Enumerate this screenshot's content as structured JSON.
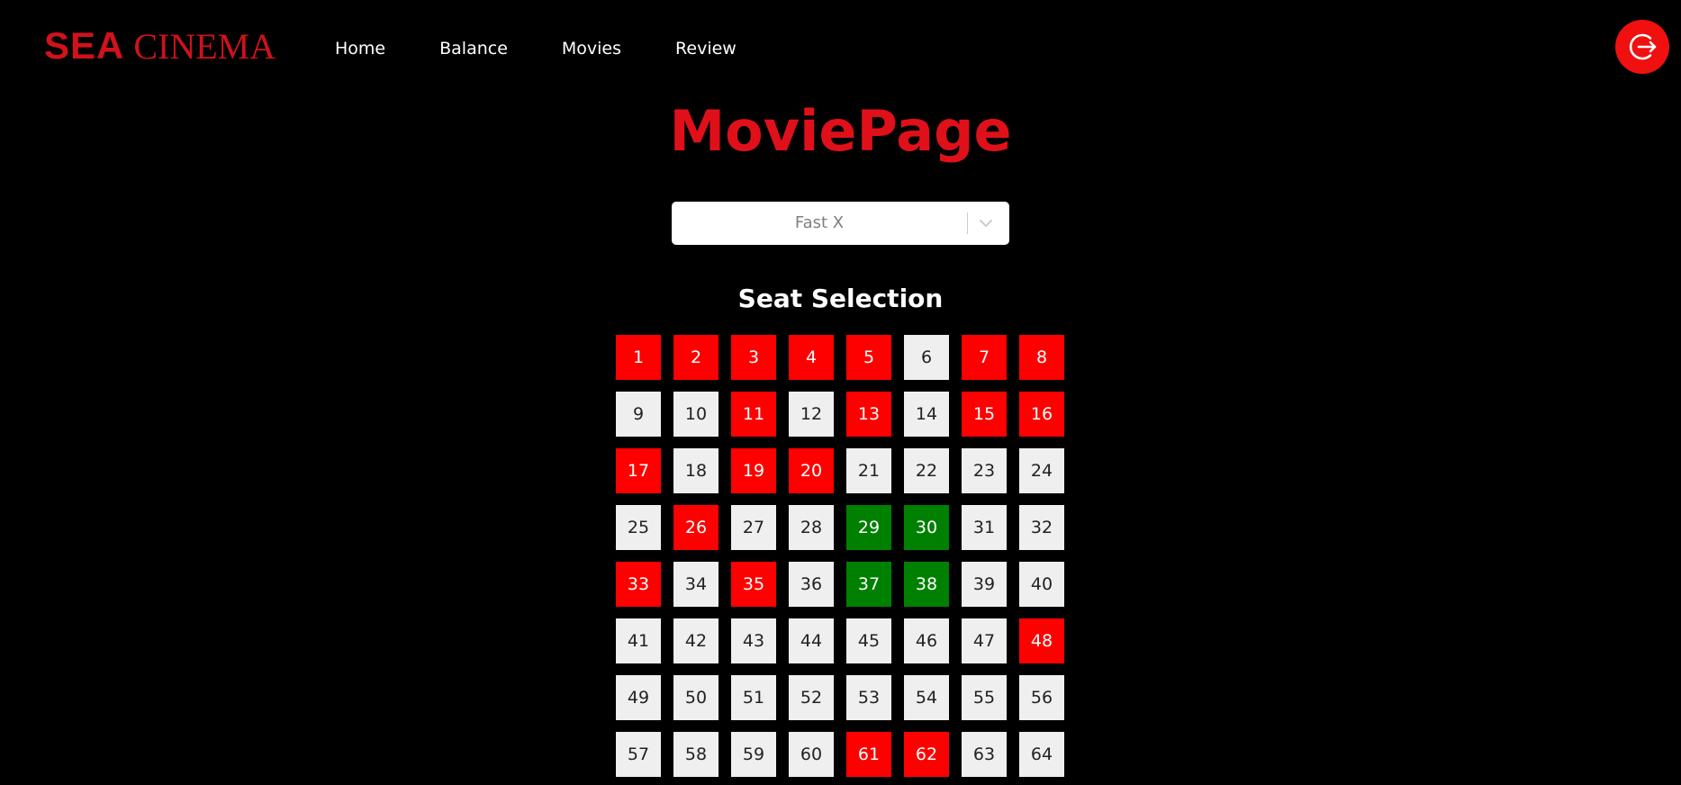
{
  "navbar": {
    "logo_main": "SEA",
    "logo_sub": "CINEMA",
    "links": [
      {
        "label": "Home"
      },
      {
        "label": "Balance"
      },
      {
        "label": "Movies"
      },
      {
        "label": "Review"
      }
    ],
    "logout_icon": "logout-icon"
  },
  "page": {
    "title": "MoviePage"
  },
  "movie_select": {
    "value": "Fast X",
    "arrow_icon": "chevron-down-icon"
  },
  "seats": {
    "title": "Seat Selection",
    "colors": {
      "available": "#efefef",
      "booked": "#ff0000",
      "selected": "#008000"
    },
    "items": [
      {
        "n": "1",
        "s": "booked"
      },
      {
        "n": "2",
        "s": "booked"
      },
      {
        "n": "3",
        "s": "booked"
      },
      {
        "n": "4",
        "s": "booked"
      },
      {
        "n": "5",
        "s": "booked"
      },
      {
        "n": "6",
        "s": "available"
      },
      {
        "n": "7",
        "s": "booked"
      },
      {
        "n": "8",
        "s": "booked"
      },
      {
        "n": "9",
        "s": "available"
      },
      {
        "n": "10",
        "s": "available"
      },
      {
        "n": "11",
        "s": "booked"
      },
      {
        "n": "12",
        "s": "available"
      },
      {
        "n": "13",
        "s": "booked"
      },
      {
        "n": "14",
        "s": "available"
      },
      {
        "n": "15",
        "s": "booked"
      },
      {
        "n": "16",
        "s": "booked"
      },
      {
        "n": "17",
        "s": "booked"
      },
      {
        "n": "18",
        "s": "available"
      },
      {
        "n": "19",
        "s": "booked"
      },
      {
        "n": "20",
        "s": "booked"
      },
      {
        "n": "21",
        "s": "available"
      },
      {
        "n": "22",
        "s": "available"
      },
      {
        "n": "23",
        "s": "available"
      },
      {
        "n": "24",
        "s": "available"
      },
      {
        "n": "25",
        "s": "available"
      },
      {
        "n": "26",
        "s": "booked"
      },
      {
        "n": "27",
        "s": "available"
      },
      {
        "n": "28",
        "s": "available"
      },
      {
        "n": "29",
        "s": "selected"
      },
      {
        "n": "30",
        "s": "selected"
      },
      {
        "n": "31",
        "s": "available"
      },
      {
        "n": "32",
        "s": "available"
      },
      {
        "n": "33",
        "s": "booked"
      },
      {
        "n": "34",
        "s": "available"
      },
      {
        "n": "35",
        "s": "booked"
      },
      {
        "n": "36",
        "s": "available"
      },
      {
        "n": "37",
        "s": "selected"
      },
      {
        "n": "38",
        "s": "selected"
      },
      {
        "n": "39",
        "s": "available"
      },
      {
        "n": "40",
        "s": "available"
      },
      {
        "n": "41",
        "s": "available"
      },
      {
        "n": "42",
        "s": "available"
      },
      {
        "n": "43",
        "s": "available"
      },
      {
        "n": "44",
        "s": "available"
      },
      {
        "n": "45",
        "s": "available"
      },
      {
        "n": "46",
        "s": "available"
      },
      {
        "n": "47",
        "s": "available"
      },
      {
        "n": "48",
        "s": "booked"
      },
      {
        "n": "49",
        "s": "available"
      },
      {
        "n": "50",
        "s": "available"
      },
      {
        "n": "51",
        "s": "available"
      },
      {
        "n": "52",
        "s": "available"
      },
      {
        "n": "53",
        "s": "available"
      },
      {
        "n": "54",
        "s": "available"
      },
      {
        "n": "55",
        "s": "available"
      },
      {
        "n": "56",
        "s": "available"
      },
      {
        "n": "57",
        "s": "available"
      },
      {
        "n": "58",
        "s": "available"
      },
      {
        "n": "59",
        "s": "available"
      },
      {
        "n": "60",
        "s": "available"
      },
      {
        "n": "61",
        "s": "booked"
      },
      {
        "n": "62",
        "s": "booked"
      },
      {
        "n": "63",
        "s": "available"
      },
      {
        "n": "64",
        "s": "available"
      }
    ]
  }
}
